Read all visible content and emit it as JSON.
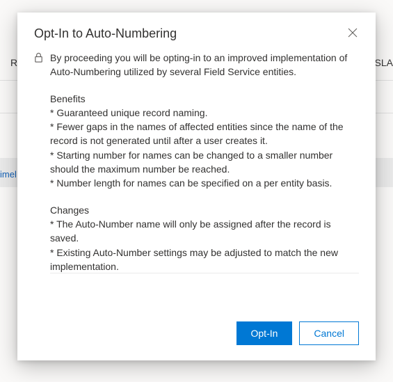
{
  "background": {
    "left_text": "R",
    "right_text": "e SLA",
    "link_text": "imel"
  },
  "modal": {
    "title": "Opt-In to Auto-Numbering",
    "intro": "By proceeding you will be opting-in to an improved implementation of Auto-Numbering utilized by several Field Service entities.",
    "benefits_header": "Benefits",
    "benefits": {
      "b1": "* Guaranteed unique record naming.",
      "b2": "* Fewer gaps in the names of affected entities since the name of the record is not generated until after a user creates it.",
      "b3": "* Starting number for names can be changed to a smaller number should the maximum number be reached.",
      "b4": "* Number length for names can be specified on a per entity basis."
    },
    "changes_header": "Changes",
    "changes": {
      "c1": "* The Auto-Number name will only be assigned after the record is saved.",
      "c2": "* Existing Auto-Number settings may be adjusted to match the new implementation."
    },
    "buttons": {
      "opt_in": "Opt-In",
      "cancel": "Cancel"
    }
  }
}
